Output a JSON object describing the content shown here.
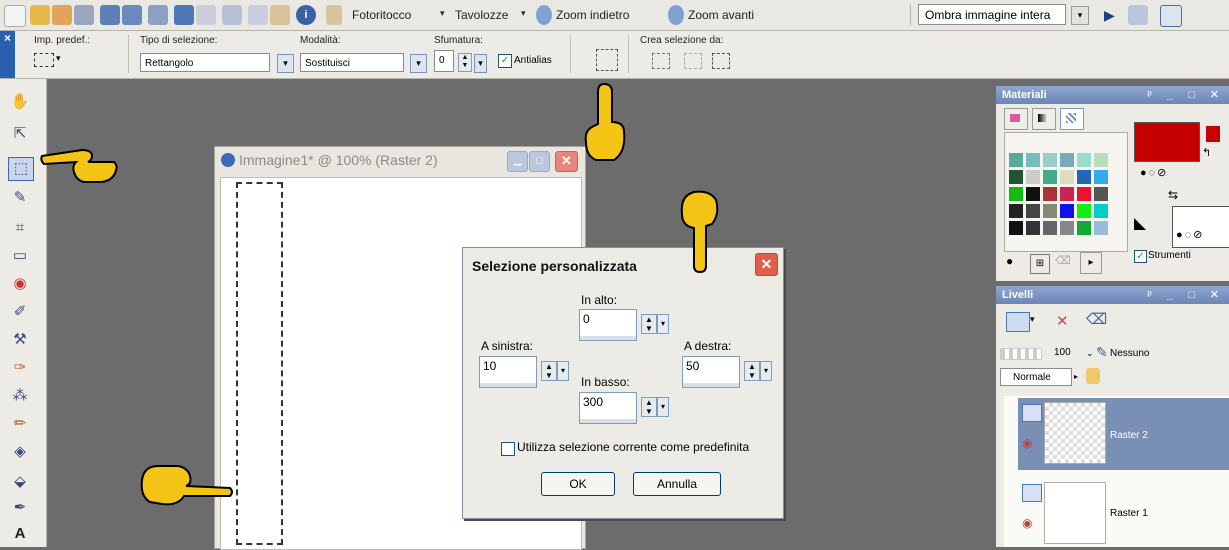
{
  "toolbar": {
    "fotoritocco_label": "Fotoritocco",
    "tavolozze_label": "Tavolozze",
    "zoom_out_label": "Zoom indietro",
    "zoom_in_label": "Zoom avanti",
    "view_select_value": "Ombra immagine intera"
  },
  "options": {
    "close_label": "×",
    "imp_predef_label": "Imp. predef.:",
    "tipo_label": "Tipo di selezione:",
    "tipo_value": "Rettangolo",
    "modalita_label": "Modalità:",
    "modalita_value": "Sostituisci",
    "sfumatura_label": "Sfumatura:",
    "sfumatura_value": "0",
    "antialias_label": "Antialias",
    "crea_label": "Crea selezione da:"
  },
  "image_window": {
    "title": "Immagine1* @ 100% (Raster 2)"
  },
  "dialog": {
    "title": "Selezione personalizzata",
    "in_alto_label": "In alto:",
    "in_alto_value": "0",
    "a_sinistra_label": "A sinistra:",
    "a_sinistra_value": "10",
    "a_destra_label": "A destra:",
    "a_destra_value": "50",
    "in_basso_label": "In basso:",
    "in_basso_value": "300",
    "checkbox_label": "Utilizza selezione corrente come predefinita",
    "ok_label": "OK",
    "cancel_label": "Annulla"
  },
  "materials": {
    "title": "Materiali",
    "strumenti_label": "Strumenti",
    "foreground_color": "#c40000"
  },
  "layers": {
    "title": "Livelli",
    "opacity_value": "100",
    "blend_none_label": "Nessuno",
    "blend_mode_value": "Normale",
    "items": [
      {
        "name": "Raster 2"
      },
      {
        "name": "Raster 1"
      }
    ]
  }
}
